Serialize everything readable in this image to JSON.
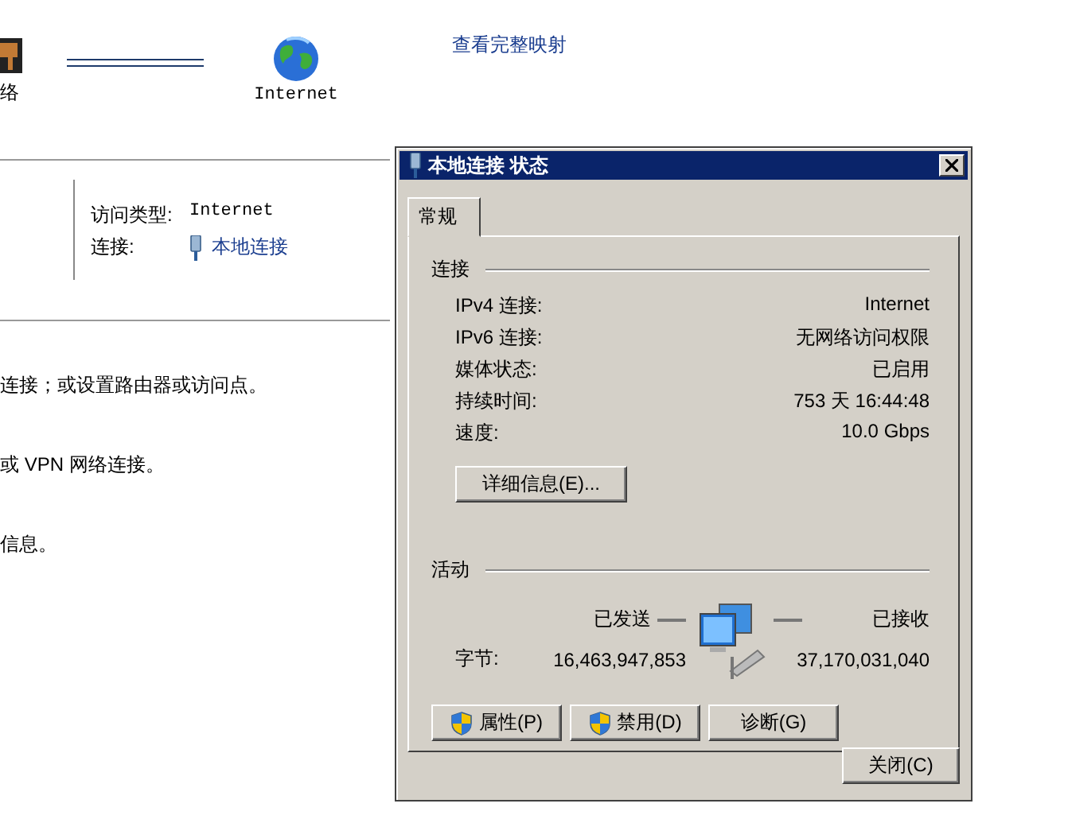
{
  "map": {
    "nodes": [
      {
        "kind": "network",
        "label": "络"
      },
      {
        "kind": "internet",
        "label": "Internet"
      }
    ],
    "full_map_link": "查看完整映射"
  },
  "network": {
    "access_type_label": "访问类型:",
    "access_type": "Internet",
    "connection_label": "连接:",
    "connection": "本地连接"
  },
  "tasks": [
    "连接；或设置路由器或访问点。",
    "或 VPN 网络连接。",
    "信息。"
  ],
  "dialog": {
    "title": "本地连接 状态",
    "tabs": [
      {
        "label": "常规",
        "selected": true
      }
    ],
    "connection_group": {
      "title": "连接",
      "rows": [
        {
          "label": "IPv4 连接:",
          "value": "Internet"
        },
        {
          "label": "IPv6 连接:",
          "value": "无网络访问权限"
        },
        {
          "label": "媒体状态:",
          "value": "已启用"
        },
        {
          "label": "持续时间:",
          "value": "753 天 16:44:48"
        },
        {
          "label": "速度:",
          "value": "10.0 Gbps"
        }
      ]
    },
    "details_button": "详细信息(E)...",
    "activity": {
      "title": "活动",
      "sent_label": "已发送",
      "received_label": "已接收",
      "bytes_label": "字节:",
      "bytes_sent": "16,463,947,853",
      "bytes_received": "37,170,031,040"
    },
    "buttons": [
      {
        "label": "属性(P)",
        "shield": true
      },
      {
        "label": "禁用(D)",
        "shield": true
      },
      {
        "label": "诊断(G)",
        "shield": false
      }
    ],
    "close_button": "关闭(C)"
  }
}
